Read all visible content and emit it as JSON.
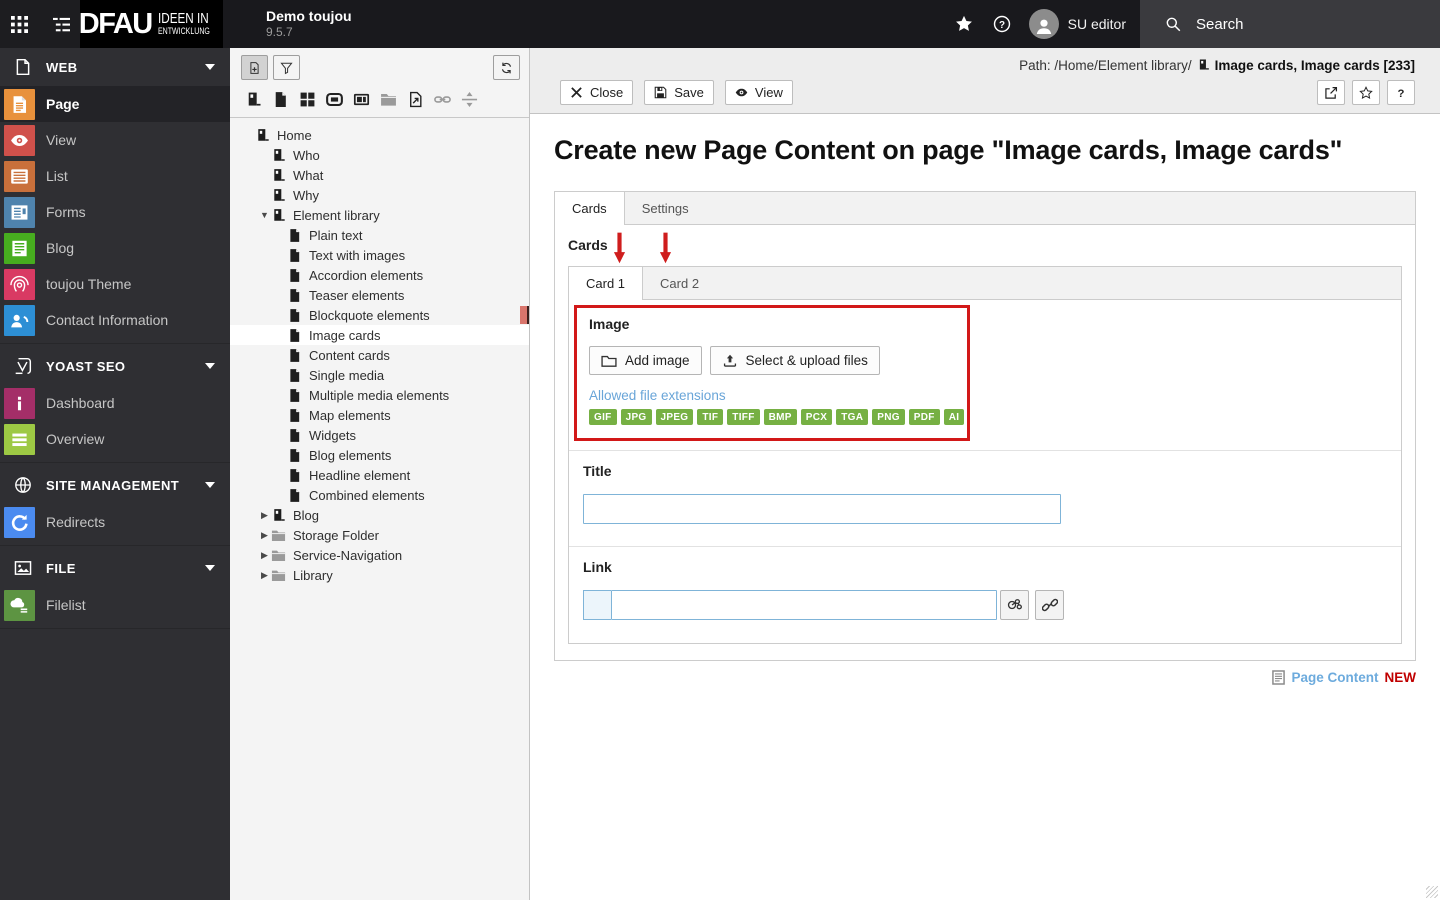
{
  "topbar": {
    "left_icons": [
      "modules-grid-icon",
      "page-tree-toggle-icon"
    ],
    "logo": {
      "main": "DFAU",
      "sub1": "IDEEN IN",
      "sub2": "ENTWICKLUNG"
    },
    "site_name": "Demo toujou",
    "version": "9.5.7",
    "bookmark_icon": "star-icon",
    "help_icon": "help-icon",
    "user": {
      "name": "SU editor",
      "icon": "avatar-icon"
    },
    "search": {
      "label": "Search",
      "icon": "search-icon"
    }
  },
  "sidebar": {
    "sections": [
      {
        "label": "WEB",
        "icon": "document-icon",
        "chevron": "chevron-down-icon",
        "items": [
          {
            "label": "Page",
            "icon": "page-module-icon",
            "color": "#e8913c",
            "active": true
          },
          {
            "label": "View",
            "icon": "view-module-icon",
            "color": "#d0514b"
          },
          {
            "label": "List",
            "icon": "list-module-icon",
            "color": "#c9703b"
          },
          {
            "label": "Forms",
            "icon": "forms-module-icon",
            "color": "#4f83ad"
          },
          {
            "label": "Blog",
            "icon": "blog-module-icon",
            "color": "#47ad1f"
          },
          {
            "label": "toujou Theme",
            "icon": "theme-module-icon",
            "color": "#d93a63"
          },
          {
            "label": "Contact Information",
            "icon": "contact-module-icon",
            "color": "#2d8fd5"
          }
        ]
      },
      {
        "label": "YOAST SEO",
        "icon": "yoast-icon",
        "chevron": "chevron-down-icon",
        "items": [
          {
            "label": "Dashboard",
            "icon": "info-module-icon",
            "color": "#a42e68"
          },
          {
            "label": "Overview",
            "icon": "overview-module-icon",
            "color": "#9dc944"
          }
        ]
      },
      {
        "label": "SITE MANAGEMENT",
        "icon": "globe-icon",
        "chevron": "chevron-down-icon",
        "items": [
          {
            "label": "Redirects",
            "icon": "redirects-module-icon",
            "color": "#4b8bf0"
          }
        ]
      },
      {
        "label": "FILE",
        "icon": "image-icon",
        "chevron": "chevron-down-icon",
        "items": [
          {
            "label": "Filelist",
            "icon": "filelist-module-icon",
            "color": "#5d9442"
          }
        ]
      }
    ]
  },
  "pagetree": {
    "toolbar": {
      "buttons": [
        {
          "name": "new-page-icon",
          "active": true
        },
        {
          "name": "filter-icon",
          "active": false
        }
      ],
      "refresh": "refresh-icon",
      "page_types": [
        "door-page-icon",
        "new-document-icon",
        "grid-page-icon",
        "mountpoint-icon",
        "plugin-page-icon",
        "folder-gray-icon",
        "shortcut-page-icon",
        "external-link-icon",
        "spacer-icon"
      ]
    },
    "nodes": [
      {
        "label": "Home",
        "level": 0,
        "icon": "page-icon",
        "caret": "none"
      },
      {
        "label": "Who",
        "level": 1,
        "icon": "page-icon",
        "caret": "none"
      },
      {
        "label": "What",
        "level": 1,
        "icon": "page-icon",
        "caret": "none"
      },
      {
        "label": "Why",
        "level": 1,
        "icon": "page-icon",
        "caret": "none"
      },
      {
        "label": "Element library",
        "level": 1,
        "icon": "page-icon",
        "caret": "expanded"
      },
      {
        "label": "Plain text",
        "level": 2,
        "icon": "doc-icon",
        "caret": "none"
      },
      {
        "label": "Text with images",
        "level": 2,
        "icon": "doc-icon",
        "caret": "none"
      },
      {
        "label": "Accordion elements",
        "level": 2,
        "icon": "doc-icon",
        "caret": "none"
      },
      {
        "label": "Teaser elements",
        "level": 2,
        "icon": "doc-icon",
        "caret": "none"
      },
      {
        "label": "Blockquote elements",
        "level": 2,
        "icon": "doc-icon",
        "caret": "none",
        "marker": true
      },
      {
        "label": "Image cards",
        "level": 2,
        "icon": "doc-icon",
        "caret": "none",
        "selected": true
      },
      {
        "label": "Content cards",
        "level": 2,
        "icon": "doc-icon",
        "caret": "none"
      },
      {
        "label": "Single media",
        "level": 2,
        "icon": "doc-icon",
        "caret": "none"
      },
      {
        "label": "Multiple media elements",
        "level": 2,
        "icon": "doc-icon",
        "caret": "none"
      },
      {
        "label": "Map elements",
        "level": 2,
        "icon": "doc-icon",
        "caret": "none"
      },
      {
        "label": "Widgets",
        "level": 2,
        "icon": "doc-icon",
        "caret": "none"
      },
      {
        "label": "Blog elements",
        "level": 2,
        "icon": "doc-icon",
        "caret": "none"
      },
      {
        "label": "Headline element",
        "level": 2,
        "icon": "doc-icon",
        "caret": "none"
      },
      {
        "label": "Combined elements",
        "level": 2,
        "icon": "doc-icon",
        "caret": "none"
      },
      {
        "label": "Blog",
        "level": 1,
        "icon": "page-icon",
        "caret": "collapsed"
      },
      {
        "label": "Storage Folder",
        "level": 1,
        "icon": "folder-icon",
        "caret": "collapsed"
      },
      {
        "label": "Service-Navigation",
        "level": 1,
        "icon": "folder-icon",
        "caret": "collapsed"
      },
      {
        "label": "Library",
        "level": 1,
        "icon": "folder-icon",
        "caret": "collapsed"
      }
    ]
  },
  "docheader": {
    "path_prefix": "Path: /Home/Element library/",
    "record_icon": "page-icon",
    "record_title": "Image cards, Image cards [233]",
    "buttons": {
      "close": "Close",
      "save": "Save",
      "view": "View"
    },
    "button_icons": {
      "close": "close-icon",
      "save": "save-icon",
      "view": "view-eye-icon"
    },
    "icon_buttons": [
      "open-new-window-icon",
      "bookmark-star-icon",
      "help-question-icon"
    ]
  },
  "main": {
    "title": "Create new Page Content on page \"Image cards, Image cards\"",
    "tabs": [
      {
        "label": "Cards",
        "active": true
      },
      {
        "label": "Settings",
        "active": false
      }
    ],
    "cards_label": "Cards",
    "annotations": {
      "arrow_icon": "red-arrow-icon",
      "count": 2
    },
    "card_tabs": [
      {
        "label": "Card 1",
        "active": true
      },
      {
        "label": "Card 2",
        "active": false
      }
    ],
    "image_section": {
      "label": "Image",
      "add_button": "Add image",
      "add_button_icon": "folder-open-icon",
      "upload_button": "Select & upload files",
      "upload_button_icon": "upload-icon",
      "allowed_label": "Allowed file extensions",
      "extensions": [
        "GIF",
        "JPG",
        "JPEG",
        "TIF",
        "TIFF",
        "BMP",
        "PCX",
        "TGA",
        "PNG",
        "PDF",
        "AI"
      ]
    },
    "title_field": {
      "label": "Title",
      "value": ""
    },
    "link_field": {
      "label": "Link",
      "value": "",
      "wizard_icon": "link-wizard-icon",
      "chain_icon": "link-chain-icon"
    },
    "footer": {
      "icon": "content-element-icon",
      "record_type": "Page Content",
      "status": "NEW"
    }
  }
}
